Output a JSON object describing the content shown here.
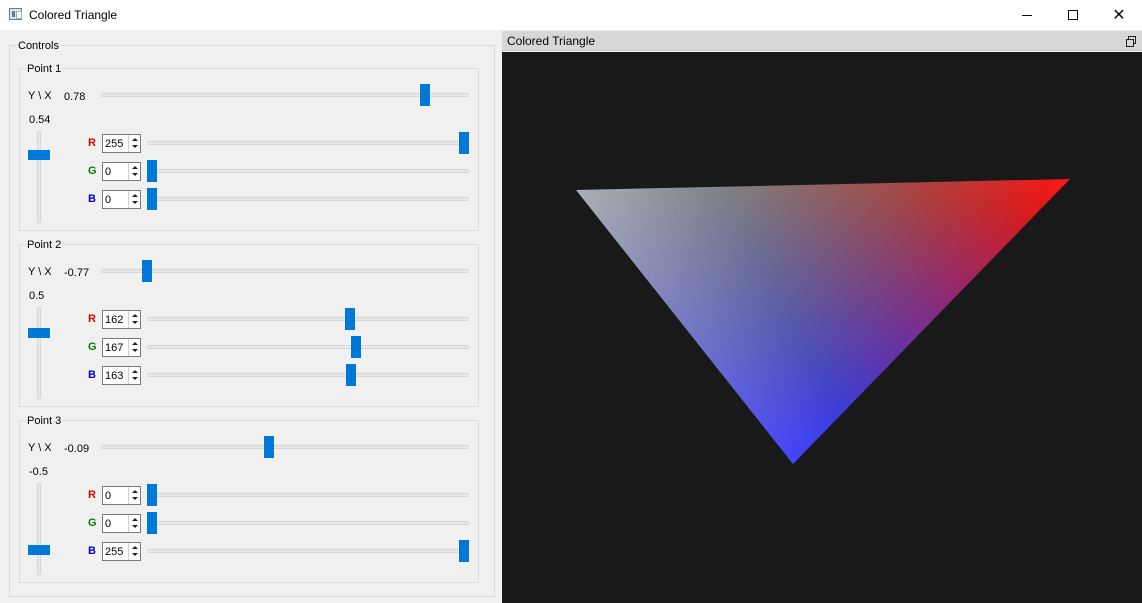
{
  "window": {
    "title": "Colored Triangle",
    "icon": "app-window-icon",
    "buttons": [
      "minimize-icon",
      "maximize-icon",
      "close-icon"
    ]
  },
  "controls": {
    "title": "Controls",
    "points": [
      {
        "title": "Point 1",
        "yx_label": "Y \\ X",
        "x": "0.78",
        "y": "0.54",
        "x_value": 0.78,
        "y_value": 0.54,
        "channels": [
          {
            "label": "R",
            "value": "255",
            "num": 255
          },
          {
            "label": "G",
            "value": "0",
            "num": 0
          },
          {
            "label": "B",
            "value": "0",
            "num": 0
          }
        ]
      },
      {
        "title": "Point 2",
        "yx_label": "Y \\ X",
        "x": "-0.77",
        "y": "0.5",
        "x_value": -0.77,
        "y_value": 0.5,
        "channels": [
          {
            "label": "R",
            "value": "162",
            "num": 162
          },
          {
            "label": "G",
            "value": "167",
            "num": 167
          },
          {
            "label": "B",
            "value": "163",
            "num": 163
          }
        ]
      },
      {
        "title": "Point 3",
        "yx_label": "Y \\ X",
        "x": "-0.09",
        "y": "-0.5",
        "x_value": -0.09,
        "y_value": -0.5,
        "channels": [
          {
            "label": "R",
            "value": "0",
            "num": 0
          },
          {
            "label": "G",
            "value": "0",
            "num": 0
          },
          {
            "label": "B",
            "value": "255",
            "num": 255
          }
        ]
      }
    ]
  },
  "render": {
    "title": "Colored Triangle",
    "restore_icon": "restore-icon",
    "background": "#191919",
    "vertex_colors": [
      "#ff0000",
      "#a2a7a3",
      "#0000ff"
    ]
  },
  "colors": {
    "accent": "#0078d7",
    "red_label": "#e00000",
    "green_label": "#008000",
    "blue_label": "#0000c8"
  }
}
